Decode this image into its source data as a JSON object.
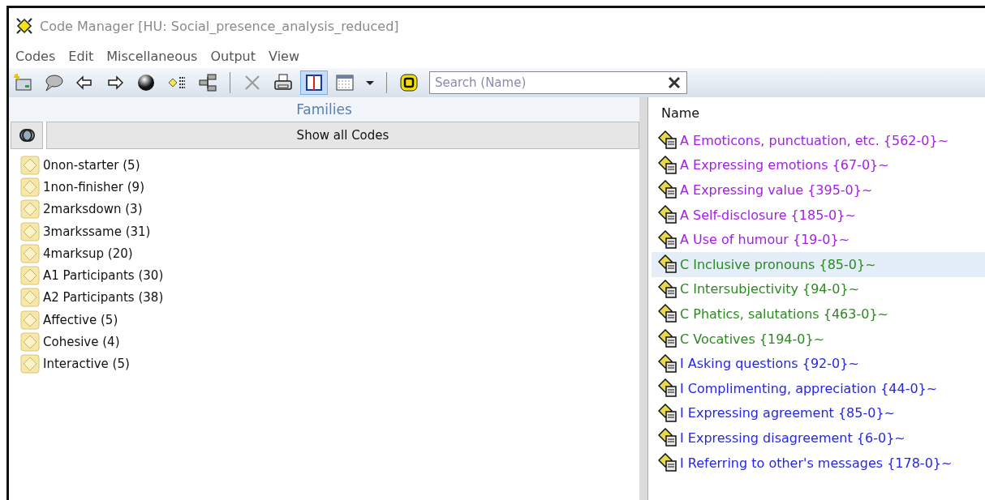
{
  "window": {
    "title": "Code Manager [HU: Social_presence_analysis_reduced]"
  },
  "menu": [
    "Codes",
    "Edit",
    "Miscellaneous",
    "Output",
    "View"
  ],
  "toolbar": [
    {
      "kind": "new",
      "pressed": false
    },
    {
      "kind": "comment",
      "pressed": false
    },
    {
      "kind": "back",
      "pressed": false
    },
    {
      "kind": "forward",
      "pressed": false
    },
    {
      "kind": "sphere",
      "pressed": false
    },
    {
      "kind": "diamond",
      "pressed": false
    },
    {
      "kind": "tree",
      "pressed": false
    },
    {
      "kind": "separator"
    },
    {
      "kind": "delete",
      "pressed": false
    },
    {
      "kind": "print",
      "pressed": false
    },
    {
      "kind": "split",
      "pressed": true
    },
    {
      "kind": "table",
      "pressed": false
    },
    {
      "kind": "dropdown",
      "pressed": false
    },
    {
      "kind": "separator"
    },
    {
      "kind": "filter",
      "pressed": false
    }
  ],
  "search": {
    "placeholder": "Search (Name)"
  },
  "families": {
    "title": "Families",
    "show_all": "Show all Codes",
    "items": [
      {
        "label": "0non-starter (5)"
      },
      {
        "label": "1non-finisher (9)"
      },
      {
        "label": "2marksdown (3)"
      },
      {
        "label": "3markssame (31)"
      },
      {
        "label": "4marksup (20)"
      },
      {
        "label": "A1 Participants (30)"
      },
      {
        "label": "A2 Participants (38)"
      },
      {
        "label": "Affective (5)"
      },
      {
        "label": "Cohesive (4)"
      },
      {
        "label": "Interactive (5)"
      }
    ]
  },
  "codes": {
    "column": "Name",
    "rows": [
      {
        "label": "A Emoticons, punctuation, etc. {562-0}~",
        "color": "#a41de8",
        "selected": false
      },
      {
        "label": "A Expressing emotions {67-0}~",
        "color": "#a41de8",
        "selected": false
      },
      {
        "label": "A Expressing value {395-0}~",
        "color": "#a41de8",
        "selected": false
      },
      {
        "label": "A Self-disclosure {185-0}~",
        "color": "#a41de8",
        "selected": false
      },
      {
        "label": "A Use of humour {19-0}~",
        "color": "#a41de8",
        "selected": false
      },
      {
        "label": "C Inclusive pronouns {85-0}~",
        "color": "#2b8a1f",
        "selected": true
      },
      {
        "label": "C Intersubjectivity {94-0}~",
        "color": "#2b8a1f",
        "selected": false
      },
      {
        "label": "C Phatics, salutations {463-0}~",
        "color": "#2b8a1f",
        "selected": false
      },
      {
        "label": "C Vocatives {194-0}~",
        "color": "#2b8a1f",
        "selected": false
      },
      {
        "label": "I Asking questions {92-0}~",
        "color": "#2626e6",
        "selected": false
      },
      {
        "label": "I Complimenting, appreciation {44-0}~",
        "color": "#2626e6",
        "selected": false
      },
      {
        "label": "I Expressing agreement {85-0}~",
        "color": "#2626e6",
        "selected": false
      },
      {
        "label": "I Expressing disagreement {6-0}~",
        "color": "#2626e6",
        "selected": false
      },
      {
        "label": "I Referring to other's messages {178-0}~",
        "color": "#2626e6",
        "selected": false
      }
    ]
  }
}
